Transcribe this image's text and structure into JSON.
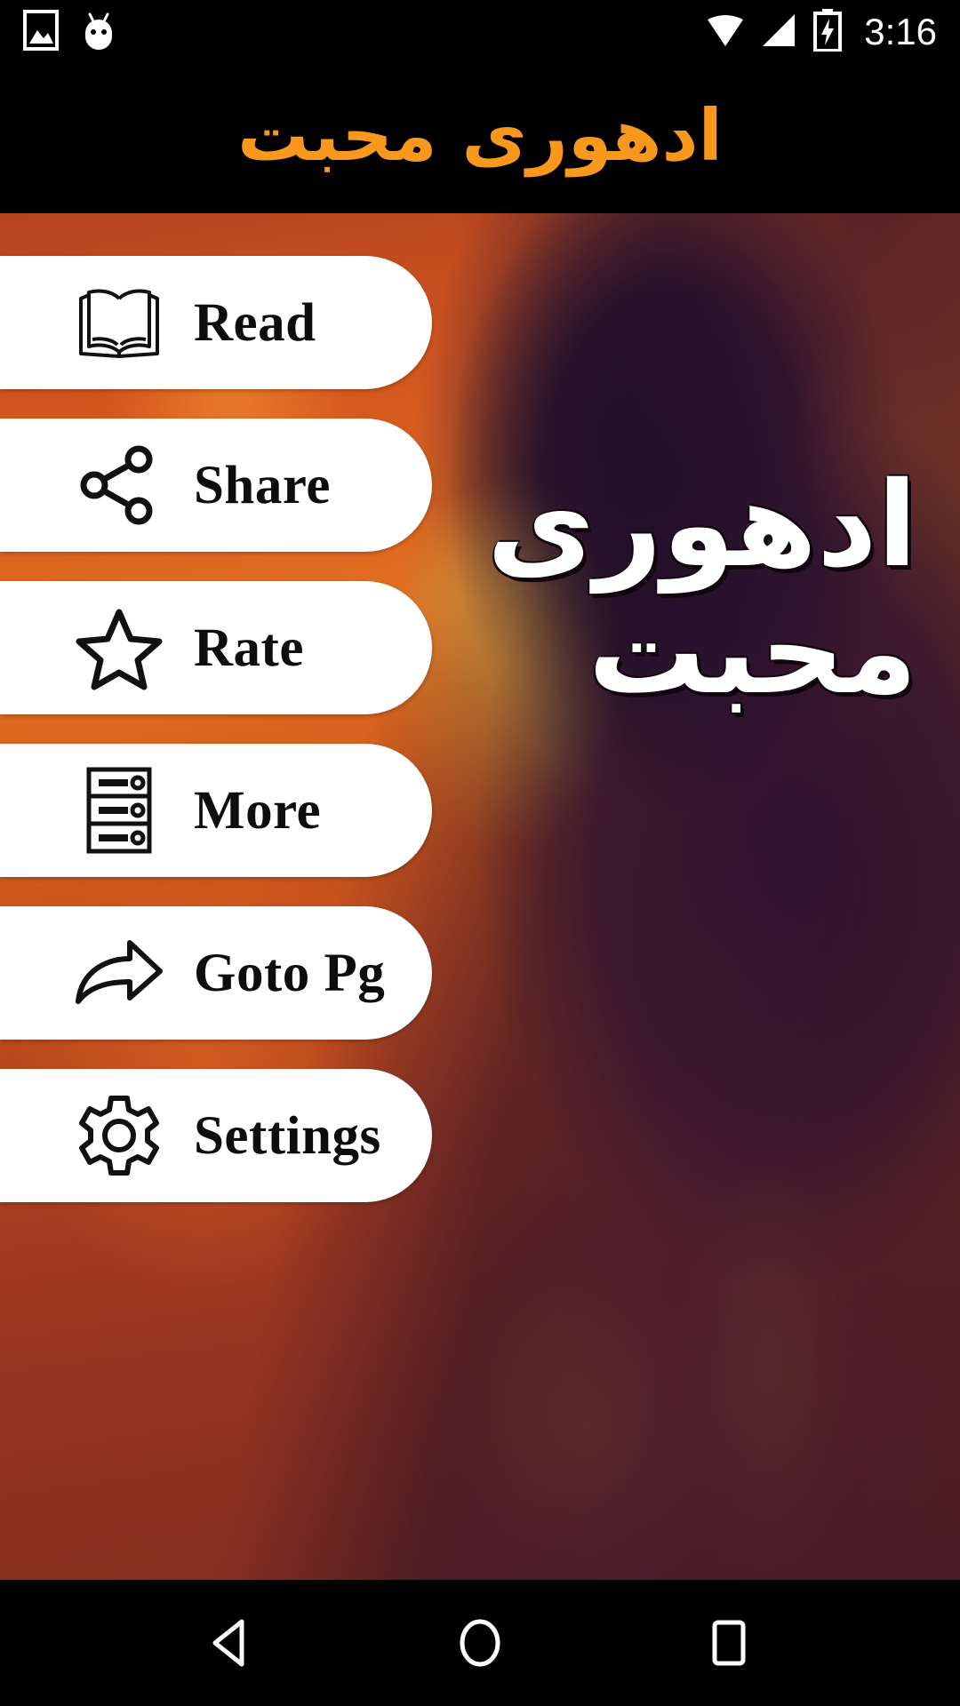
{
  "status_bar": {
    "icons": [
      "photo-icon",
      "android-marshmallow-icon"
    ],
    "wifi_icon": "wifi-icon",
    "signal_icon": "cellular-signal-icon",
    "battery_icon": "battery-charging-icon",
    "time": "3:16"
  },
  "header": {
    "title": "ادهوری محبت",
    "title_color": "#F8981D",
    "background_color": "#000000"
  },
  "background": {
    "calligraphy_lines": [
      "ادھوری",
      "محبت"
    ],
    "description": "fiery orange and purple artwork of a woman's silhouette"
  },
  "menu": {
    "items": [
      {
        "id": "read",
        "label": "Read",
        "icon": "open-book-icon"
      },
      {
        "id": "share",
        "label": "Share",
        "icon": "share-nodes-icon"
      },
      {
        "id": "rate",
        "label": "Rate",
        "icon": "star-outline-icon"
      },
      {
        "id": "more",
        "label": "More",
        "icon": "server-list-icon"
      },
      {
        "id": "goto_pg",
        "label": "Goto Pg",
        "icon": "curved-arrow-right-icon"
      },
      {
        "id": "settings",
        "label": "Settings",
        "icon": "gear-icon"
      }
    ],
    "button_background": "#FFFFFF",
    "text_color": "#0D0D0D"
  },
  "nav_bar": {
    "back_label": "Back",
    "home_label": "Home",
    "recents_label": "Recent apps",
    "background_color": "#000000"
  }
}
